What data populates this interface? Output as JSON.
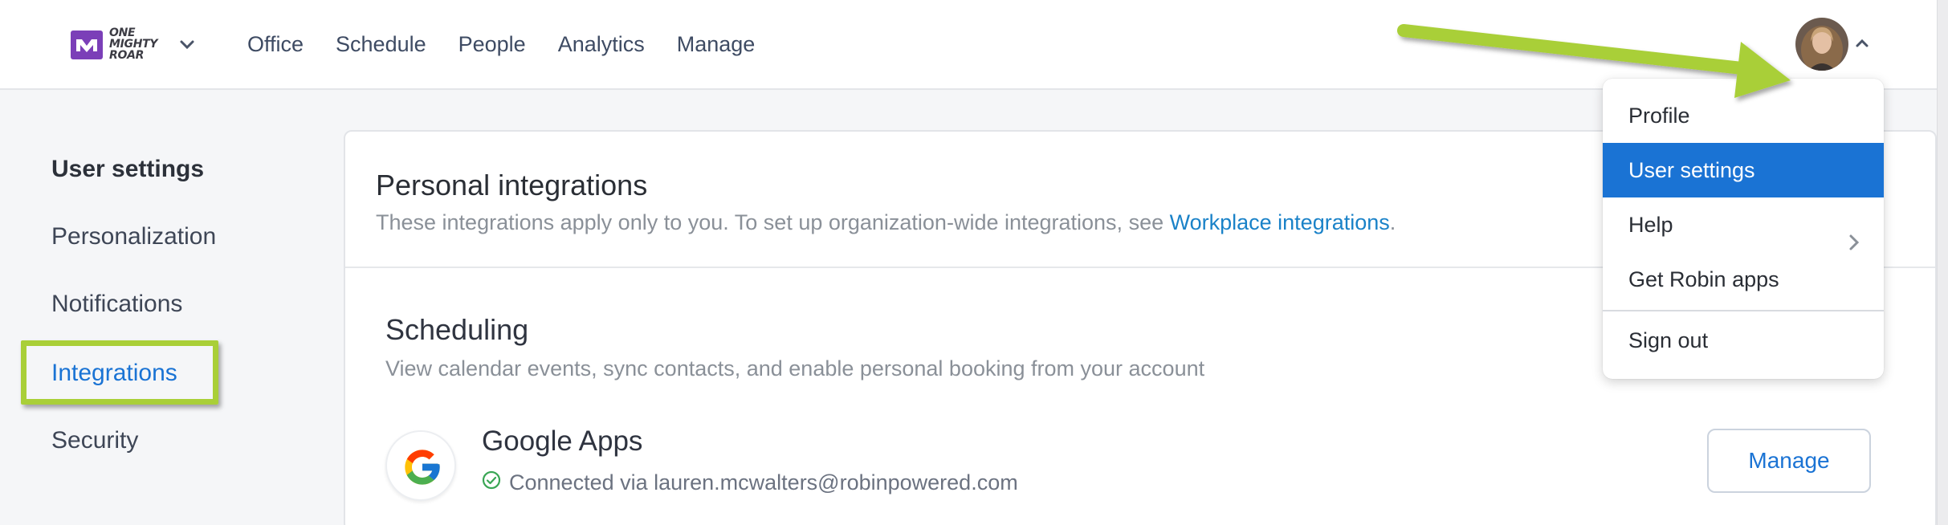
{
  "header": {
    "logo_lines": [
      "ONE",
      "MIGHTY",
      "ROAR"
    ],
    "nav": [
      "Office",
      "Schedule",
      "People",
      "Analytics",
      "Manage"
    ]
  },
  "sidebar": {
    "heading": "User settings",
    "items": [
      {
        "label": "Personalization"
      },
      {
        "label": "Notifications"
      },
      {
        "label": "Integrations"
      },
      {
        "label": "Security"
      }
    ]
  },
  "card": {
    "title": "Personal integrations",
    "subtitle_prefix": "These integrations apply only to you. To set up organization-wide integrations, see ",
    "subtitle_link": "Workplace integrations",
    "subtitle_suffix": ".",
    "section": {
      "title": "Scheduling",
      "description": "View calendar events, sync contacts, and enable personal booking from your account",
      "app": {
        "name": "Google Apps",
        "status": "Connected via lauren.mcwalters@robinpowered.com",
        "button": "Manage"
      }
    }
  },
  "user_menu": {
    "items": [
      {
        "label": "Profile"
      },
      {
        "label": "User settings"
      },
      {
        "label": "Help"
      },
      {
        "label": "Get Robin apps"
      },
      {
        "label": "Sign out"
      }
    ]
  },
  "colors": {
    "accent": "#1a73d4",
    "annotation": "#a9cf38",
    "connected": "#3aa655"
  }
}
